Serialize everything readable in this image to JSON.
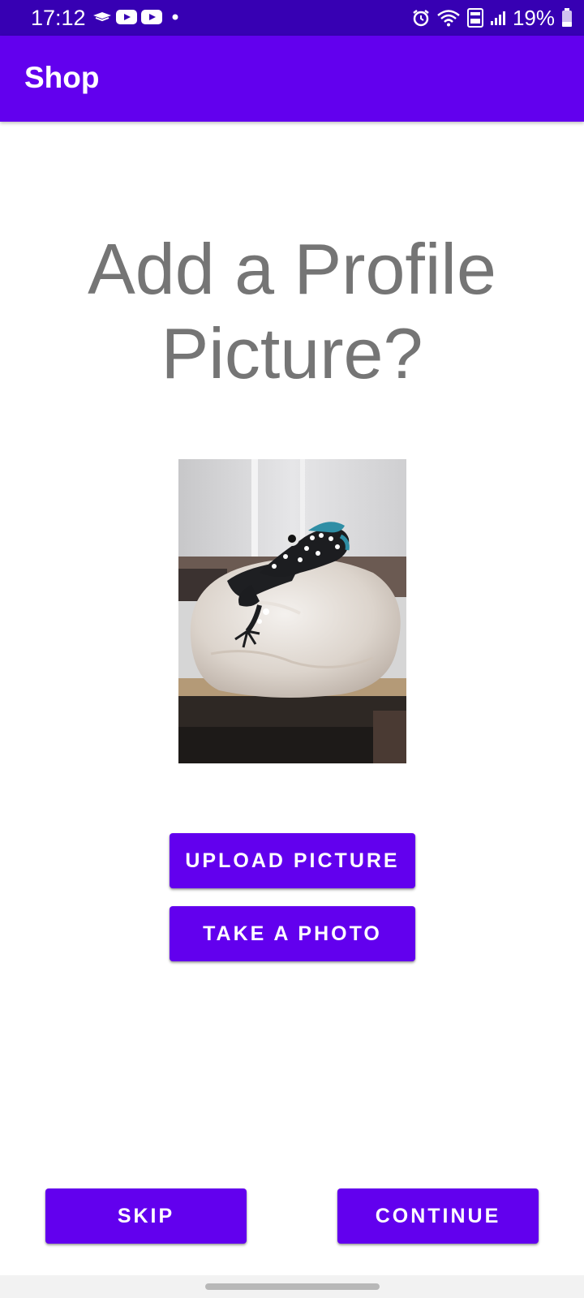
{
  "status_bar": {
    "time": "17:12",
    "left_icons": [
      "notification-icon",
      "youtube-icon",
      "youtube-icon",
      "dot-icon"
    ],
    "right_icons": [
      "alarm-icon",
      "wifi-icon",
      "volte-4g-icon",
      "signal-icon"
    ],
    "battery": "19%"
  },
  "app_bar": {
    "title": "Shop"
  },
  "main": {
    "headline": "Add a Profile Picture?",
    "profile_picture": "photo of a clay frog figurine on a white rock",
    "upload_label": "UPLOAD PICTURE",
    "take_photo_label": "TAKE A PHOTO"
  },
  "footer": {
    "skip_label": "SKIP",
    "continue_label": "CONTINUE"
  },
  "colors": {
    "primary": "#6200ee",
    "primary_dark": "#3700b3",
    "headline": "#757575"
  }
}
